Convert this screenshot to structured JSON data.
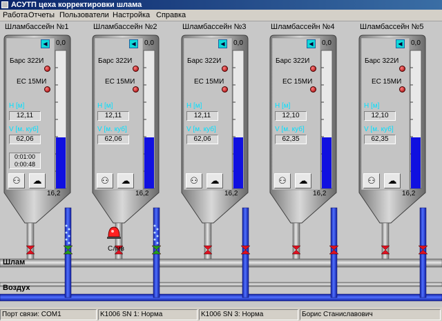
{
  "window": {
    "title": "АСУТП цеха корректировки шлама"
  },
  "menu": [
    "Работа",
    "Отчеты",
    "Пользователи",
    "Настройка",
    "Справка"
  ],
  "tanks": [
    {
      "title": "Шламбассейн №1",
      "sensor1": "Барс 322И",
      "sensor2": "ЕС 15МИ",
      "h_label": "H [м]",
      "h_value": "12,11",
      "v_label": "V [м. куб]",
      "v_value": "62,06",
      "timer1": "0:01:00",
      "timer2": "0:00:48",
      "scale_top": "0,0",
      "scale_bottom": "16,2",
      "level": 0.37
    },
    {
      "title": "Шламбассейн №2",
      "sensor1": "Барс 322И",
      "sensor2": "ЕС 15МИ",
      "h_label": "H [м]",
      "h_value": "12,11",
      "v_label": "V [м. куб]",
      "v_value": "62,06",
      "scale_top": "0,0",
      "scale_bottom": "16,2",
      "level": 0.37
    },
    {
      "title": "Шламбассейн №3",
      "sensor1": "Барс 322И",
      "sensor2": "ЕС 15МИ",
      "h_label": "H [м]",
      "h_value": "12,11",
      "v_label": "V [м. куб]",
      "v_value": "62,06",
      "scale_top": "0,0",
      "scale_bottom": "16,2",
      "level": 0.37
    },
    {
      "title": "Шламбассейн №4",
      "sensor1": "Барс 322И",
      "sensor2": "ЕС 15МИ",
      "h_label": "H [м]",
      "h_value": "12,10",
      "v_label": "V [м. куб]",
      "v_value": "62,35",
      "scale_top": "0,0",
      "scale_bottom": "16,2",
      "level": 0.37
    },
    {
      "title": "Шламбассейн №5",
      "sensor1": "Барс 322И",
      "sensor2": "ЕС 15МИ",
      "h_label": "H [м]",
      "h_value": "12,10",
      "v_label": "V [м. куб]",
      "v_value": "62,35",
      "scale_top": "0,0",
      "scale_bottom": "16,2",
      "level": 0.37
    }
  ],
  "pipes": {
    "slurry": "Шлам",
    "air": "Воздух"
  },
  "alarm": {
    "label": "Слив"
  },
  "status": {
    "port": "Порт связи: COM1",
    "dev1": "K1006 SN 1: Норма",
    "dev3": "K1006 SN 3: Норма",
    "user": "Борис Станиславович"
  },
  "colors": {
    "level": "#1010e0",
    "valve": "#e01020",
    "air_pipe": "#2030d0",
    "slurry_pipe": "#a8a8a8",
    "accent_cyan": "#00e0ff"
  },
  "icons": [
    "speaker-icon",
    "tap-icon",
    "aeration-icon",
    "alarm-light-icon"
  ]
}
